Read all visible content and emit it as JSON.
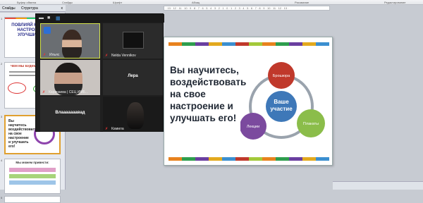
{
  "ribbon": {
    "groups": [
      "Буфер обмена",
      "Слайды",
      "Шрифт",
      "Абзац",
      "Рисование",
      "Редактирование"
    ]
  },
  "sidebar": {
    "tabs": [
      "Слайды",
      "Структура"
    ],
    "close_label": "x",
    "thumb_numbers": [
      "1",
      "2",
      "3",
      "4",
      "5"
    ],
    "thumb1_title": "ПОВЛИЯЙ НА СВОЕ НАСТРОЕНИЕ, УЛУЧШИ ЕГО!",
    "thumb2_title": "ЧЕМ МЫ БУДЕМ ЗА...",
    "thumb3_title": "Вы научитесь воздействовать на свое настроение и улучшать его!",
    "thumb4_title": "Мы можем привести:"
  },
  "ruler": {
    "text": "· 13 · 12 · 11 · 10 · 9 · 8 · 7 · 6 · 5 · 4 · 3 · 2 · 1 · 0 · 1 · 2 · 3 · 4 · 5 · 6 · 7 · 8 · 9 · 10 · 11 · 12 · 13 ·"
  },
  "video": {
    "participants": [
      {
        "name": "Ильяс",
        "label": ""
      },
      {
        "name": "Nelda Vennikov",
        "label": ""
      },
      {
        "name": "Карачаева | СЕЦ ИМБ...",
        "label": ""
      },
      {
        "name": "",
        "label": "Лера"
      },
      {
        "name": "",
        "label": "Влааааааавад"
      },
      {
        "name": "Камила",
        "label": ""
      }
    ]
  },
  "slide": {
    "title": "Вы научитесь, воздействовать на свое настроение и улучшать его!",
    "center": "Ваше участие",
    "nodes": [
      "Брошюра",
      "Плакаты",
      "Лекции"
    ],
    "colors": {
      "center": "#3e78b8",
      "brochure": "#c0392b",
      "posters": "#8bbd4a",
      "lectures": "#7b4a9e",
      "ring": "#9aa3ad"
    },
    "stripe_colors": [
      "#e8821e",
      "#2e9e4e",
      "#6a3fa0",
      "#e3a91e",
      "#3b8fd0",
      "#c0392b",
      "#a3c93a",
      "#e8821e",
      "#2e9e4e",
      "#6a3fa0",
      "#e3a91e",
      "#3b8fd0"
    ]
  }
}
